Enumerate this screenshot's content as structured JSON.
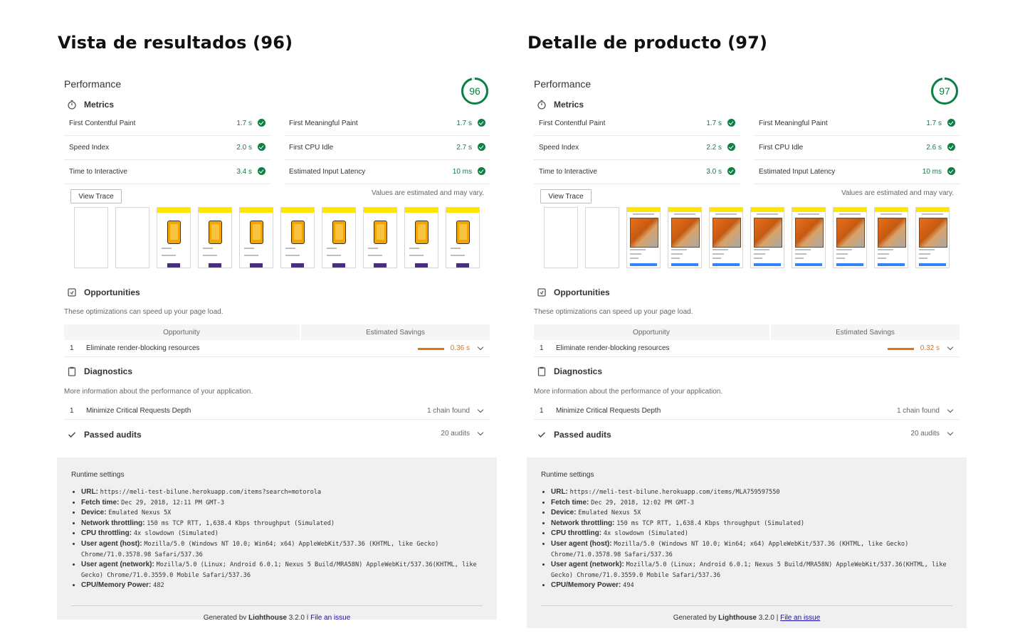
{
  "left": {
    "page_title": "Vista de resultados (96)",
    "score": 96,
    "score_text": "96",
    "filmstrip_type": "phone",
    "runtime_url": "https://meli-test-bilune.herokuapp.com/items?search=motorola",
    "runtime_fetch_time": "Dec 29, 2018, 12:11 PM GMT-3",
    "runtime_cpu_memory": "482",
    "metrics": {
      "fcp": "1.7 s",
      "fmp": "1.7 s",
      "si": "2.0 s",
      "cpu": "2.7 s",
      "tti": "3.4 s",
      "eil": "10 ms"
    },
    "opp_savings": "0.36 s"
  },
  "right": {
    "page_title": "Detalle de producto (97)",
    "score": 97,
    "score_text": "97",
    "filmstrip_type": "product",
    "runtime_url": "https://meli-test-bilune.herokuapp.com/items/MLA759597550",
    "runtime_fetch_time": "Dec 29, 2018, 12:02 PM GMT-3",
    "runtime_cpu_memory": "494",
    "metrics": {
      "fcp": "1.7 s",
      "fmp": "1.7 s",
      "si": "2.2 s",
      "cpu": "2.6 s",
      "tti": "3.0 s",
      "eil": "10 ms"
    },
    "opp_savings": "0.32 s"
  },
  "labels": {
    "performance": "Performance",
    "metrics": "Metrics",
    "fcp": "First Contentful Paint",
    "fmp": "First Meaningful Paint",
    "si": "Speed Index",
    "cpu": "First CPU Idle",
    "tti": "Time to Interactive",
    "eil": "Estimated Input Latency",
    "view_trace": "View Trace",
    "estimated_note": "Values are estimated and may vary.",
    "opportunities": "Opportunities",
    "opp_desc": "These optimizations can speed up your page load.",
    "opp_col_1": "Opportunity",
    "opp_col_2": "Estimated Savings",
    "opp_row_num": "1",
    "opp_row_name": "Eliminate render-blocking resources",
    "diagnostics": "Diagnostics",
    "diag_desc": "More information about the performance of your application.",
    "diag_row_num": "1",
    "diag_row_name": "Minimize Critical Requests Depth",
    "diag_row_val": "1 chain found",
    "passed_audits": "Passed audits",
    "passed_count": "20 audits",
    "runtime_settings": "Runtime settings",
    "k_url": "URL:",
    "k_fetch": "Fetch time:",
    "k_device": "Device:",
    "v_device": "Emulated Nexus 5X",
    "k_network": "Network throttling:",
    "v_network": "150 ms TCP RTT, 1,638.4 Kbps throughput (Simulated)",
    "k_cpu": "CPU throttling:",
    "v_cpu": "4x slowdown (Simulated)",
    "k_ua_host": "User agent (host):",
    "v_ua_host": "Mozilla/5.0 (Windows NT 10.0; Win64; x64) AppleWebKit/537.36 (KHTML, like Gecko) Chrome/71.0.3578.98 Safari/537.36",
    "k_ua_net": "User agent (network):",
    "v_ua_net": "Mozilla/5.0 (Linux; Android 6.0.1; Nexus 5 Build/MRA58N) AppleWebKit/537.36(KHTML, like Gecko) Chrome/71.0.3559.0 Mobile Safari/537.36",
    "k_cpumem": "CPU/Memory Power:",
    "footer_generated": "Generated by",
    "footer_lighthouse": "Lighthouse",
    "footer_version": "3.2.0 |",
    "footer_link": "File an issue"
  },
  "colors": {
    "pass_green": "#0b8043",
    "average_orange": "#e8710a",
    "link_blue": "#1a0dab"
  },
  "icons": [
    "stopwatch-icon",
    "check-circle-icon",
    "opportunity-icon",
    "clipboard-icon",
    "checkmark-icon",
    "chevron-down-icon"
  ]
}
